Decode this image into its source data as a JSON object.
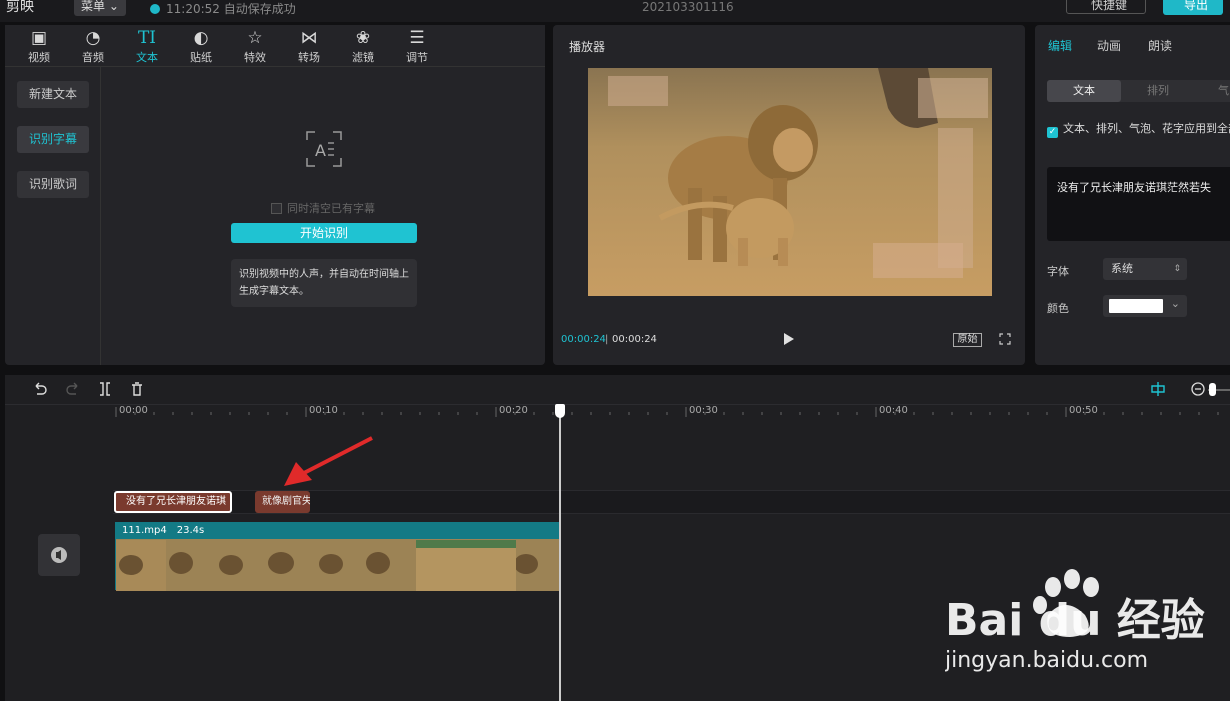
{
  "topbar": {
    "logo": "剪映",
    "menu_label": "菜单",
    "save_status": "11:20:52 自动保存成功",
    "project_name": "202103301116",
    "shortcut_label": "快捷键",
    "export_label": "导出"
  },
  "media_tabs": [
    {
      "label": "视频",
      "icon": "video-icon"
    },
    {
      "label": "音频",
      "icon": "audio-icon"
    },
    {
      "label": "文本",
      "icon": "text-icon"
    },
    {
      "label": "贴纸",
      "icon": "sticker-icon"
    },
    {
      "label": "特效",
      "icon": "effects-icon"
    },
    {
      "label": "转场",
      "icon": "transition-icon"
    },
    {
      "label": "滤镜",
      "icon": "filter-icon"
    },
    {
      "label": "调节",
      "icon": "adjust-icon"
    }
  ],
  "text_side": {
    "new_text": "新建文本",
    "recognize_subtitles": "识别字幕",
    "recognize_lyrics": "识别歌词"
  },
  "recognize": {
    "clear_checkbox_label": "同时清空已有字幕",
    "start_button": "开始识别",
    "description": "识别视频中的人声，并自动在时间轴上生成字幕文本。"
  },
  "player": {
    "title": "播放器",
    "current_time": "00:00:24",
    "total_time": "00:00:24",
    "separator": "|",
    "original_label": "原始"
  },
  "props": {
    "tabs": [
      "编辑",
      "动画",
      "朗读"
    ],
    "segments": [
      "文本",
      "排列",
      "气"
    ],
    "apply_all_label": "文本、排列、气泡、花字应用到全部",
    "text_content": "没有了兄长津朋友诺琪茫然若失",
    "font_label": "字体",
    "font_value": "系统",
    "color_label": "颜色",
    "color_value": "#ffffff"
  },
  "timeline": {
    "ticks": [
      "00:00",
      "00:10",
      "00:20",
      "00:30",
      "00:40",
      "00:50"
    ],
    "subtitle_clips": [
      "没有了兄长津朋友诺琪",
      "就像剧官失"
    ],
    "video_clip": {
      "name": "111.mp4",
      "duration": "23.4s"
    }
  },
  "watermark": {
    "text": "Bai du 经验",
    "url_text": "jingyan.baidu.com"
  }
}
